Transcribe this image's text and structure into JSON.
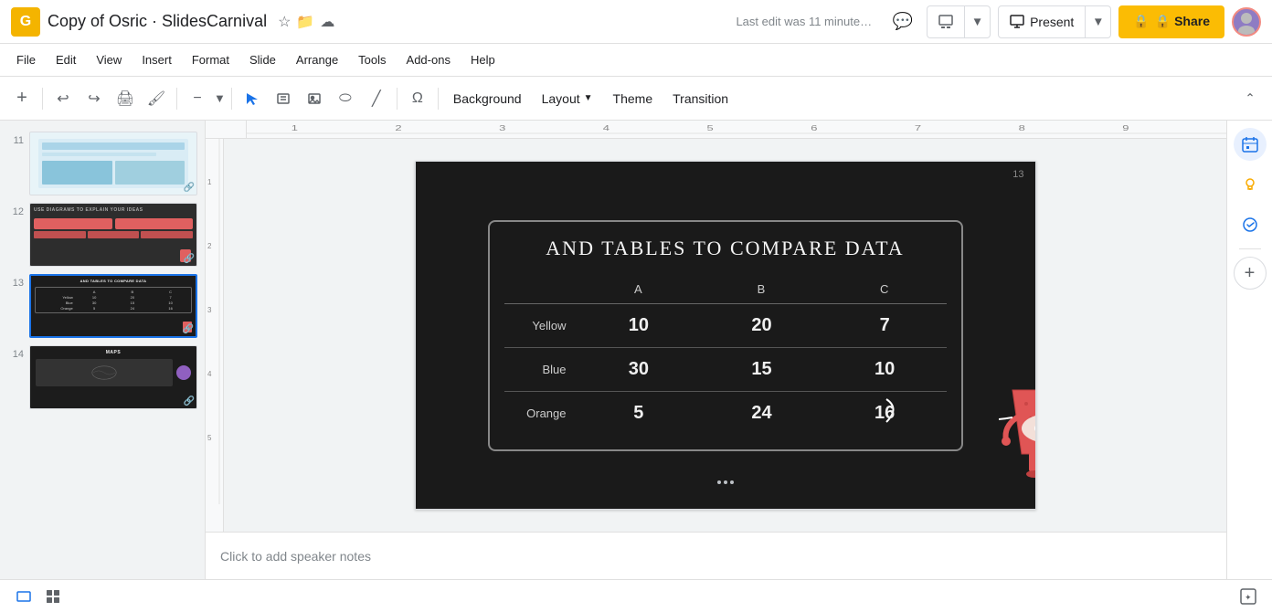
{
  "app": {
    "icon": "G",
    "title": "Copy of Osric · SlidesCarnival",
    "last_edit": "Last edit was 11 minute…"
  },
  "header": {
    "comment_icon": "💬",
    "slide_options_label": "▤",
    "present_label": "Present",
    "share_label": "🔒 Share"
  },
  "menu": {
    "items": [
      "File",
      "Edit",
      "View",
      "Insert",
      "Format",
      "Slide",
      "Arrange",
      "Tools",
      "Add-ons",
      "Help"
    ]
  },
  "toolbar": {
    "background_label": "Background",
    "layout_label": "Layout",
    "theme_label": "Theme",
    "transition_label": "Transition"
  },
  "slides": [
    {
      "num": "11",
      "active": false
    },
    {
      "num": "12",
      "active": false
    },
    {
      "num": "13",
      "active": true
    },
    {
      "num": "14",
      "active": false
    }
  ],
  "slide": {
    "number": "13",
    "title": "And tables to compare data",
    "table": {
      "headers": [
        "",
        "A",
        "B",
        "C"
      ],
      "rows": [
        {
          "label": "Yellow",
          "a": "10",
          "b": "20",
          "c": "7"
        },
        {
          "label": "Blue",
          "a": "30",
          "b": "15",
          "c": "10"
        },
        {
          "label": "Orange",
          "a": "5",
          "b": "24",
          "c": "16"
        }
      ]
    }
  },
  "notes": {
    "placeholder": "Click to add speaker notes"
  },
  "right_sidebar": {
    "icons": [
      "calendar",
      "lightbulb",
      "checkmark",
      "add"
    ]
  },
  "bottom": {
    "view_grid_icon": "⊞",
    "view_list_icon": "☰"
  }
}
